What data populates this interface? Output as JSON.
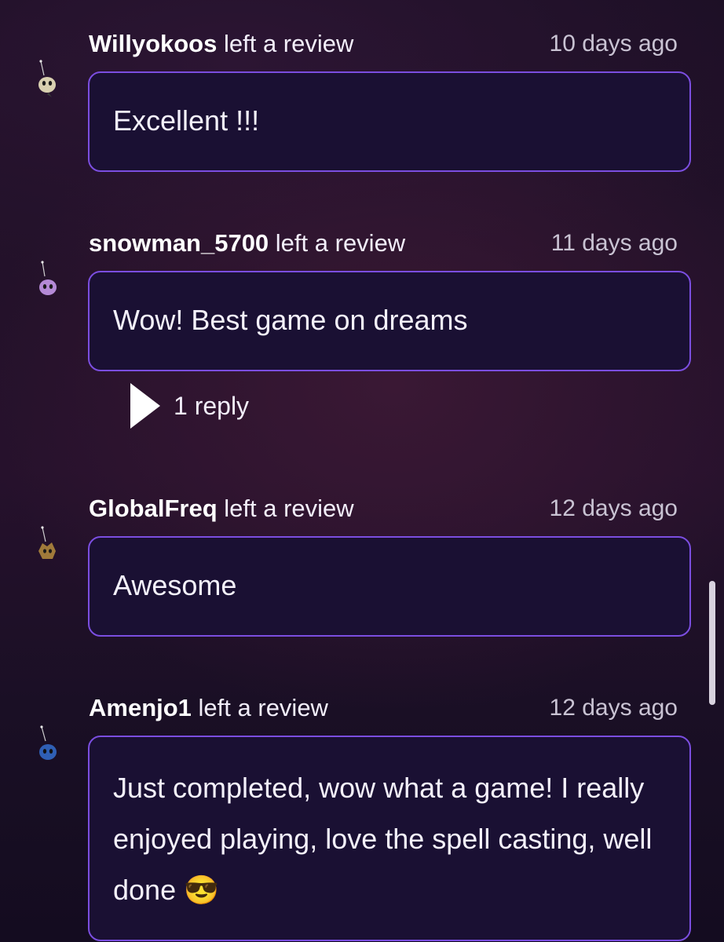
{
  "reviews": [
    {
      "username": "Willyokoos",
      "action": "left a review",
      "time": "10 days ago",
      "text": "Excellent !!!",
      "avatar_color": "#d9d0b0"
    },
    {
      "username": "snowman_5700",
      "action": "left a review",
      "time": "11 days ago",
      "text": "Wow! Best game on dreams",
      "avatar_color": "#b48ad6",
      "reply_label": "1 reply"
    },
    {
      "username": "GlobalFreq",
      "action": "left a review",
      "time": "12 days ago",
      "text": "Awesome",
      "avatar_color": "#a07a3a"
    },
    {
      "username": "Amenjo1",
      "action": "left a review",
      "time": "12 days ago",
      "text": "Just completed, wow what a game! I really enjoyed playing, love the spell casting, well done 😎",
      "avatar_color": "#2f5fb4"
    }
  ],
  "colors": {
    "bubble_border": "#7b4ee0",
    "bubble_fill": "#1a1033",
    "background": "#221129"
  },
  "icons": {
    "avatar": "imp-avatar-icon",
    "expand": "play-triangle-icon"
  }
}
